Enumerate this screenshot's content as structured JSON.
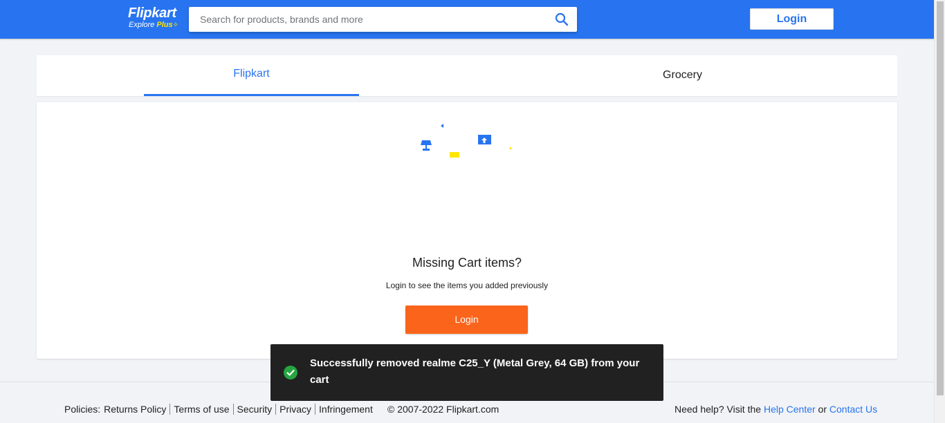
{
  "header": {
    "logo_name": "Flipkart",
    "logo_sub_explore": "Explore",
    "logo_sub_plus": "Plus",
    "search_placeholder": "Search for products, brands and more",
    "login_label": "Login"
  },
  "tabs": [
    {
      "label": "Flipkart",
      "active": true
    },
    {
      "label": "Grocery",
      "active": false
    }
  ],
  "cart": {
    "title": "Missing Cart items?",
    "subtitle": "Login to see the items you added previously",
    "login_label": "Login"
  },
  "toast": {
    "message": "Successfully removed realme C25_Y (Metal Grey, 64 GB) from your cart",
    "status_color": "#26a541"
  },
  "footer": {
    "policies_label": "Policies:",
    "links": [
      "Returns Policy",
      "Terms of use",
      "Security",
      "Privacy",
      "Infringement"
    ],
    "copyright": "© 2007-2022 Flipkart.com",
    "help_prefix": "Need help? Visit the",
    "help_center": "Help Center",
    "help_or": "or",
    "contact_us": "Contact Us"
  },
  "colors": {
    "brand_blue": "#2874f0",
    "accent_orange": "#fb641b",
    "accent_yellow": "#ffe500"
  }
}
